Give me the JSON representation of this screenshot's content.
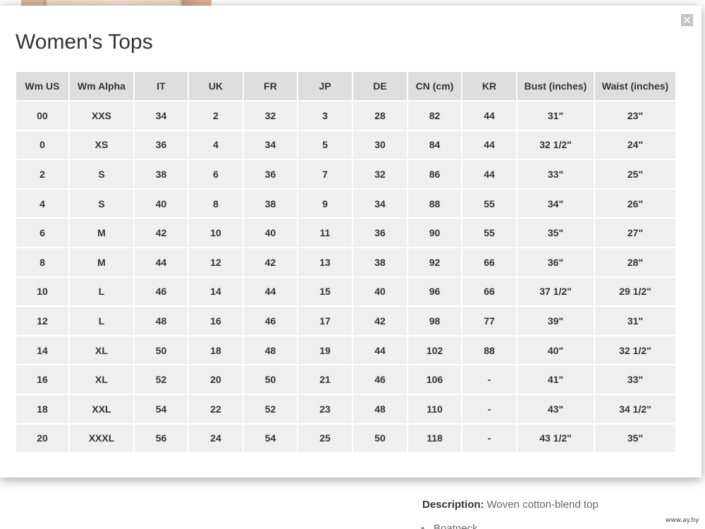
{
  "modal": {
    "title": "Women's Tops",
    "close_icon": "close-icon"
  },
  "size_table": {
    "headers": [
      "Wm US",
      "Wm Alpha",
      "IT",
      "UK",
      "FR",
      "JP",
      "DE",
      "CN (cm)",
      "KR",
      "Bust (inches)",
      "Waist (inches)"
    ],
    "rows": [
      [
        "00",
        "XXS",
        "34",
        "2",
        "32",
        "3",
        "28",
        "82",
        "44",
        "31\"",
        "23\""
      ],
      [
        "0",
        "XS",
        "36",
        "4",
        "34",
        "5",
        "30",
        "84",
        "44",
        "32 1/2\"",
        "24\""
      ],
      [
        "2",
        "S",
        "38",
        "6",
        "36",
        "7",
        "32",
        "86",
        "44",
        "33\"",
        "25\""
      ],
      [
        "4",
        "S",
        "40",
        "8",
        "38",
        "9",
        "34",
        "88",
        "55",
        "34\"",
        "26\""
      ],
      [
        "6",
        "M",
        "42",
        "10",
        "40",
        "11",
        "36",
        "90",
        "55",
        "35\"",
        "27\""
      ],
      [
        "8",
        "M",
        "44",
        "12",
        "42",
        "13",
        "38",
        "92",
        "66",
        "36\"",
        "28\""
      ],
      [
        "10",
        "L",
        "46",
        "14",
        "44",
        "15",
        "40",
        "96",
        "66",
        "37 1/2\"",
        "29 1/2\""
      ],
      [
        "12",
        "L",
        "48",
        "16",
        "46",
        "17",
        "42",
        "98",
        "77",
        "39\"",
        "31\""
      ],
      [
        "14",
        "XL",
        "50",
        "18",
        "48",
        "19",
        "44",
        "102",
        "88",
        "40\"",
        "32 1/2\""
      ],
      [
        "16",
        "XL",
        "52",
        "20",
        "50",
        "21",
        "46",
        "106",
        "-",
        "41\"",
        "33\""
      ],
      [
        "18",
        "XXL",
        "54",
        "22",
        "52",
        "23",
        "48",
        "110",
        "-",
        "43\"",
        "34 1/2\""
      ],
      [
        "20",
        "XXXL",
        "56",
        "24",
        "54",
        "25",
        "50",
        "118",
        "-",
        "43 1/2\"",
        "35\""
      ]
    ]
  },
  "product": {
    "description_label": "Description:",
    "description_text": "Woven cotton-blend top",
    "features": [
      "Boatneck"
    ]
  },
  "watermark": "www.ay.by"
}
